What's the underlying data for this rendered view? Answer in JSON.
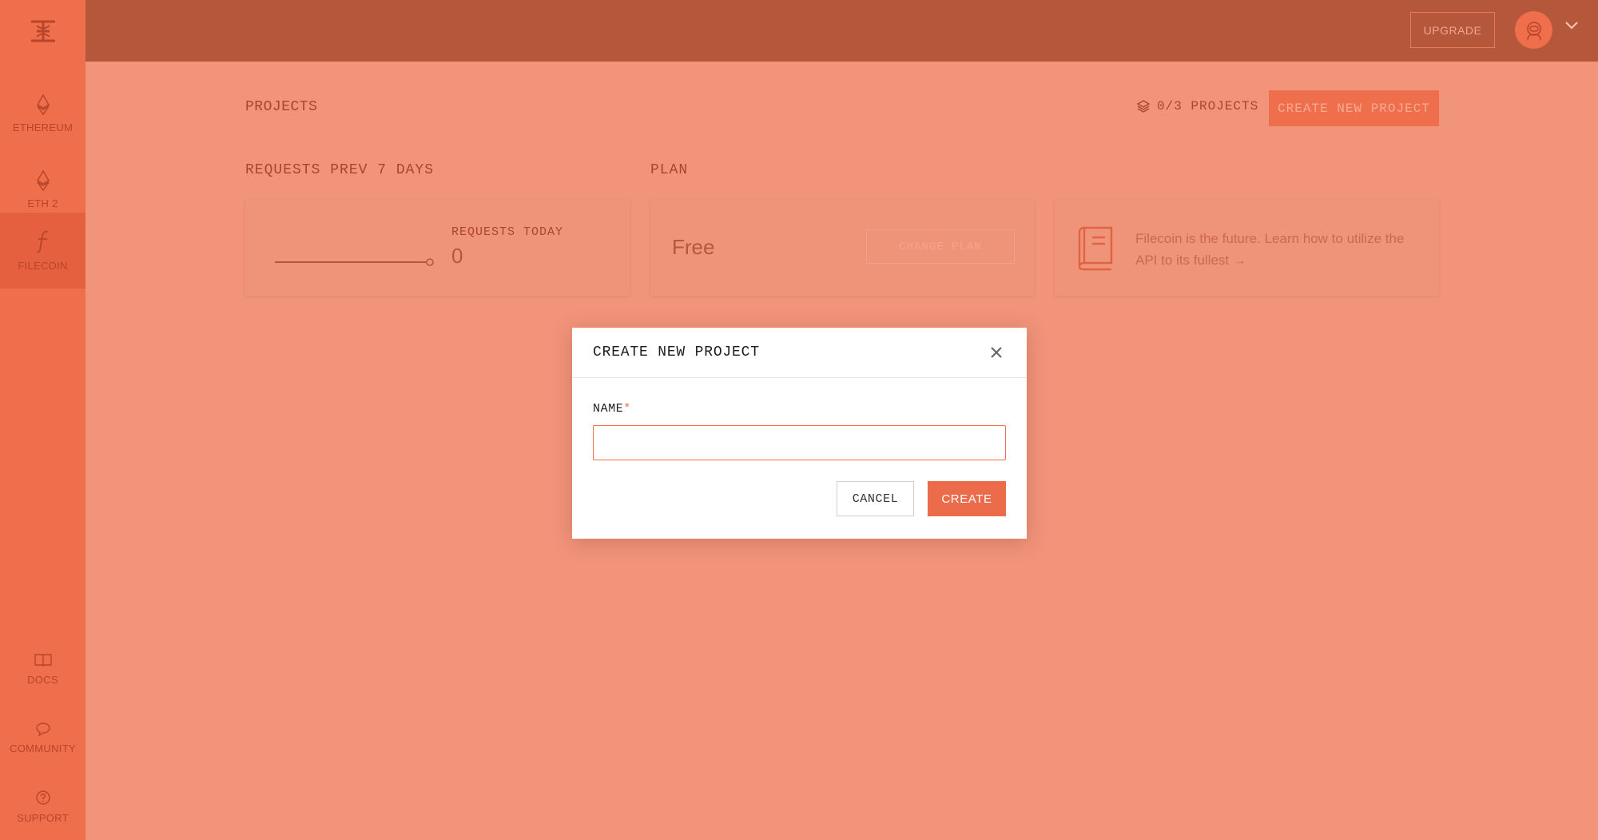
{
  "sidebar": {
    "logo_icon": "infura-logo",
    "items": [
      {
        "label": "ETHEREUM",
        "icon": "ethereum-icon",
        "active": false
      },
      {
        "label": "ETH 2",
        "icon": "ethereum-icon",
        "active": false
      },
      {
        "label": "FILECOIN",
        "icon": "filecoin-icon",
        "active": true
      }
    ],
    "bottom_items": [
      {
        "label": "DOCS",
        "icon": "book-icon"
      },
      {
        "label": "COMMUNITY",
        "icon": "chat-icon"
      },
      {
        "label": "SUPPORT",
        "icon": "help-icon"
      }
    ]
  },
  "topbar": {
    "upgrade_label": "UPGRADE",
    "avatar_icon": "astronaut-icon"
  },
  "main": {
    "title": "PROJECTS",
    "project_count": "0/3 PROJECTS",
    "create_new_label": "CREATE NEW PROJECT",
    "requests_section": "REQUESTS PREV 7 DAYS",
    "plan_section": "PLAN",
    "requests_today_label": "REQUESTS TODAY",
    "requests_today_value": "0",
    "plan_name": "Free",
    "change_plan_label": "CHANGE PLAN",
    "filecoin_promo": "Filecoin is the future. Learn how to utilize the API to its fullest →"
  },
  "modal": {
    "title": "CREATE NEW PROJECT",
    "name_label": "NAME",
    "required_marker": "*",
    "name_value": "",
    "cancel_label": "CANCEL",
    "create_label": "CREATE"
  },
  "colors": {
    "accent": "#ef6e4c",
    "overlay_topbar": "#b5573b",
    "overlay_main": "#f1947a"
  }
}
